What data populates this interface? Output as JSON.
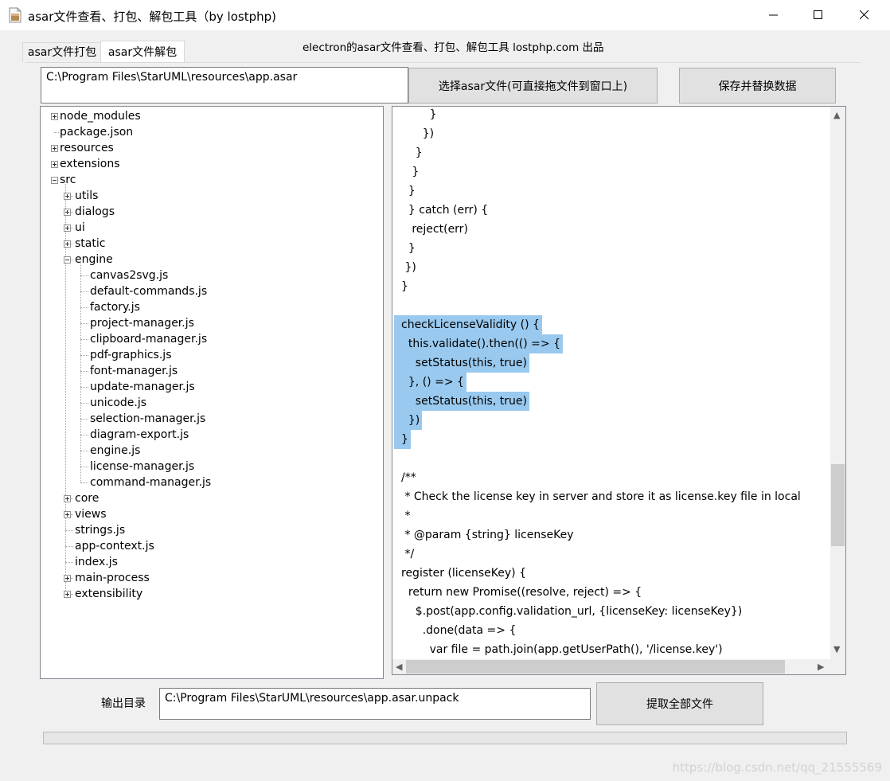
{
  "window": {
    "title": "asar文件查看、打包、解包工具（by lostphp)",
    "controls": {
      "minimize": "minimize",
      "maximize": "maximize",
      "close": "close"
    }
  },
  "tabs": [
    {
      "label": "asar文件打包",
      "active": false
    },
    {
      "label": "asar文件解包",
      "active": true
    }
  ],
  "header_caption": "electron的asar文件查看、打包、解包工具 lostphp.com 出品",
  "file_path": "C:\\Program Files\\StarUML\\resources\\app.asar",
  "buttons": {
    "select_file": "选择asar文件(可直接拖文件到窗口上)",
    "save_replace": "保存并替换数据",
    "extract_all": "提取全部文件"
  },
  "tree": [
    {
      "label": "node_modules",
      "level": 0,
      "expander": "plus"
    },
    {
      "label": "package.json",
      "level": 0,
      "expander": "none"
    },
    {
      "label": "resources",
      "level": 0,
      "expander": "plus"
    },
    {
      "label": "extensions",
      "level": 0,
      "expander": "plus"
    },
    {
      "label": "src",
      "level": 0,
      "expander": "minus"
    },
    {
      "label": "utils",
      "level": 1,
      "expander": "plus"
    },
    {
      "label": "dialogs",
      "level": 1,
      "expander": "plus"
    },
    {
      "label": "ui",
      "level": 1,
      "expander": "plus"
    },
    {
      "label": "static",
      "level": 1,
      "expander": "plus"
    },
    {
      "label": "engine",
      "level": 1,
      "expander": "minus"
    },
    {
      "label": "canvas2svg.js",
      "level": 2,
      "expander": "none"
    },
    {
      "label": "default-commands.js",
      "level": 2,
      "expander": "none"
    },
    {
      "label": "factory.js",
      "level": 2,
      "expander": "none"
    },
    {
      "label": "project-manager.js",
      "level": 2,
      "expander": "none"
    },
    {
      "label": "clipboard-manager.js",
      "level": 2,
      "expander": "none"
    },
    {
      "label": "pdf-graphics.js",
      "level": 2,
      "expander": "none"
    },
    {
      "label": "font-manager.js",
      "level": 2,
      "expander": "none"
    },
    {
      "label": "update-manager.js",
      "level": 2,
      "expander": "none"
    },
    {
      "label": "unicode.js",
      "level": 2,
      "expander": "none"
    },
    {
      "label": "selection-manager.js",
      "level": 2,
      "expander": "none"
    },
    {
      "label": "diagram-export.js",
      "level": 2,
      "expander": "none"
    },
    {
      "label": "engine.js",
      "level": 2,
      "expander": "none"
    },
    {
      "label": "license-manager.js",
      "level": 2,
      "expander": "none"
    },
    {
      "label": "command-manager.js",
      "level": 2,
      "expander": "none"
    },
    {
      "label": "core",
      "level": 1,
      "expander": "plus"
    },
    {
      "label": "views",
      "level": 1,
      "expander": "plus"
    },
    {
      "label": "strings.js",
      "level": 1,
      "expander": "none"
    },
    {
      "label": "app-context.js",
      "level": 1,
      "expander": "none"
    },
    {
      "label": "index.js",
      "level": 1,
      "expander": "none"
    },
    {
      "label": "main-process",
      "level": 1,
      "expander": "plus"
    },
    {
      "label": "extensibility",
      "level": 1,
      "expander": "plus"
    }
  ],
  "code_lines": [
    {
      "text": "        }",
      "hl": false
    },
    {
      "text": "      })",
      "hl": false
    },
    {
      "text": "    }",
      "hl": false
    },
    {
      "text": "   }",
      "hl": false
    },
    {
      "text": "  }",
      "hl": false
    },
    {
      "text": "  } catch (err) {",
      "hl": false
    },
    {
      "text": "   reject(err)",
      "hl": false
    },
    {
      "text": "  }",
      "hl": false
    },
    {
      "text": " })",
      "hl": false
    },
    {
      "text": "}",
      "hl": false
    },
    {
      "text": "",
      "hl": false
    },
    {
      "text": "checkLicenseValidity () {",
      "hl": true
    },
    {
      "text": "  this.validate().then(() => {",
      "hl": true
    },
    {
      "text": "    setStatus(this, true)",
      "hl": true
    },
    {
      "text": "  }, () => {",
      "hl": true
    },
    {
      "text": "    setStatus(this, true)",
      "hl": true
    },
    {
      "text": "  })",
      "hl": true
    },
    {
      "text": "}",
      "hl": true
    },
    {
      "text": "",
      "hl": false
    },
    {
      "text": "/**",
      "hl": false
    },
    {
      "text": " * Check the license key in server and store it as license.key file in local",
      "hl": false
    },
    {
      "text": " *",
      "hl": false
    },
    {
      "text": " * @param {string} licenseKey",
      "hl": false
    },
    {
      "text": " */",
      "hl": false
    },
    {
      "text": "register (licenseKey) {",
      "hl": false
    },
    {
      "text": "  return new Promise((resolve, reject) => {",
      "hl": false
    },
    {
      "text": "    $.post(app.config.validation_url, {licenseKey: licenseKey})",
      "hl": false
    },
    {
      "text": "      .done(data => {",
      "hl": false
    },
    {
      "text": "        var file = path.join(app.getUserPath(), '/license.key')",
      "hl": false
    }
  ],
  "output": {
    "label": "输出目录",
    "path": "C:\\Program Files\\StarUML\\resources\\app.asar.unpack"
  },
  "progress": {
    "value": 0
  },
  "watermark": "https://blog.csdn.net/qq_21555569",
  "icons": {
    "app": "document-archive-icon"
  },
  "colors": {
    "selection": "#99c9ef",
    "window_bg": "#f0f0f0"
  }
}
